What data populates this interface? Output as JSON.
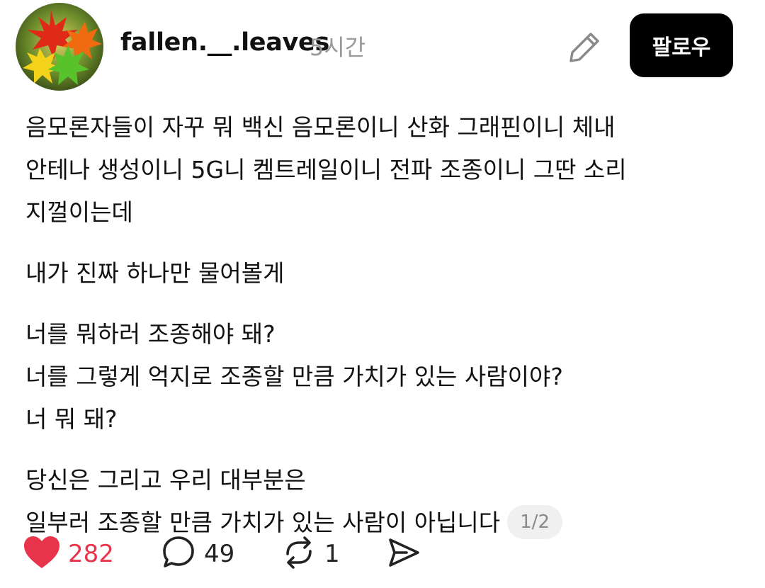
{
  "post": {
    "author": {
      "username": "fallen.__.leaves",
      "time_ago": "5시간",
      "avatar": "maple-leaves-avatar"
    },
    "follow_label": "팔로우",
    "paragraphs": [
      {
        "lines": [
          "음모론자들이 자꾸 뭐 백신 음모론이니 산화 그래핀이니 체내",
          "안테나 생성이니 5G니 켐트레일이니 전파 조종이니 그딴 소리",
          "지껄이는데"
        ]
      },
      {
        "lines": [
          "내가 진짜 하나만 물어볼게"
        ]
      },
      {
        "lines": [
          "너를 뭐하러 조종해야 돼?",
          "너를 그렇게 억지로 조종할 만큼 가치가 있는 사람이야?",
          "너 뭐 돼?"
        ]
      },
      {
        "lines": [
          "당신은 그리고 우리 대부분은",
          "일부러 조종할 만큼 가치가 있는 사람이 아닙니다"
        ]
      }
    ],
    "page_indicator": "1/2",
    "stats": {
      "likes": "282",
      "comments": "49",
      "reposts": "1"
    }
  },
  "colors": {
    "like": "#e8344b",
    "follow_bg": "#000000",
    "muted": "#9a9a9a"
  },
  "icons": {
    "edit": "pencil-icon",
    "like": "heart-icon",
    "comment": "speech-bubble-icon",
    "repost": "repost-icon",
    "share": "send-icon"
  }
}
